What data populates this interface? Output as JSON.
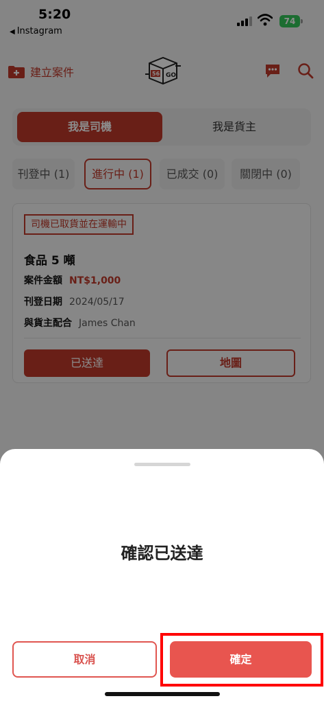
{
  "status_bar": {
    "time": "5:20",
    "back_app": "Instagram",
    "battery": "74"
  },
  "header": {
    "create_label": "建立案件",
    "logo_text": "56GO",
    "accent_color": "#c0392b"
  },
  "role_toggle": {
    "driver": "我是司機",
    "shipper": "我是貨主",
    "selected": "driver"
  },
  "filters": [
    {
      "label": "刊登中 (1)",
      "active": false
    },
    {
      "label": "進行中 (1)",
      "active": true
    },
    {
      "label": "已成交 (0)",
      "active": false
    },
    {
      "label": "關閉中 (0)",
      "active": false
    }
  ],
  "card": {
    "status": "司機已取貨並在運輸中",
    "title": "食品 5 噸",
    "amount_label": "案件金額",
    "amount_value": "NT$1,000",
    "date_label": "刊登日期",
    "date_value": "2024/05/17",
    "partner_label": "與貨主配合",
    "partner_value": "James Chan",
    "delivered_button": "已送達",
    "map_button": "地圖"
  },
  "dialog": {
    "title": "確認已送達",
    "cancel": "取消",
    "confirm": "確定"
  }
}
